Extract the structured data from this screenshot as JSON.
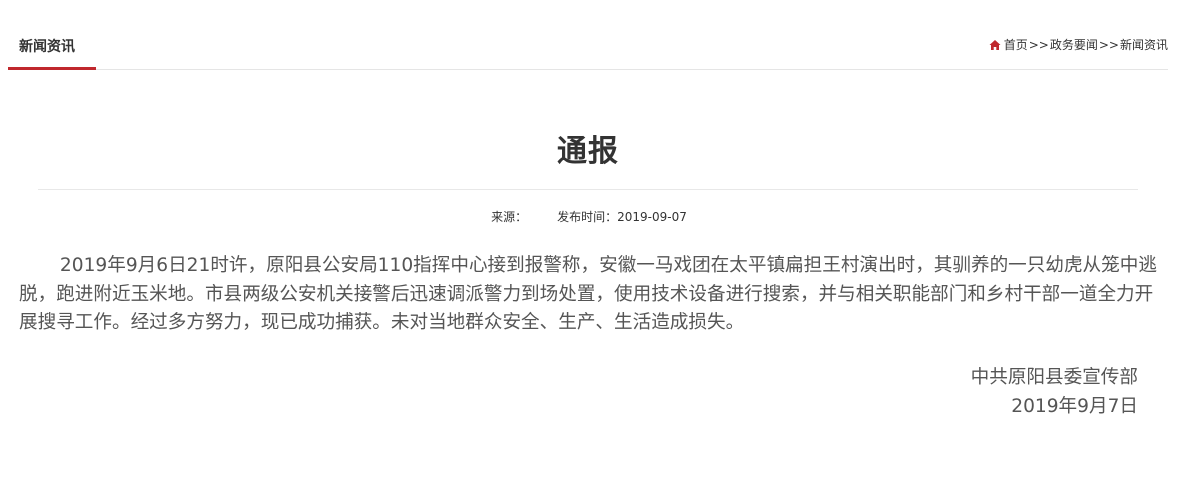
{
  "header": {
    "section_label": "新闻资讯",
    "breadcrumb": {
      "home": "首页",
      "separator": ">>",
      "level1": "政务要闻",
      "level2": "新闻资讯"
    }
  },
  "article": {
    "title": "通报",
    "source_label": "来源：",
    "source_value": "",
    "publish_label": "发布时间：",
    "publish_date": "2019-09-07",
    "body": "2019年9月6日21时许，原阳县公安局110指挥中心接到报警称，安徽一马戏团在太平镇扁担王村演出时，其驯养的一只幼虎从笼中逃脱，跑进附近玉米地。市县两级公安机关接警后迅速调派警力到场处置，使用技术设备进行搜索，并与相关职能部门和乡村干部一道全力开展搜寻工作。经过多方努力，现已成功捕获。未对当地群众安全、生产、生活造成损失。",
    "signature_org": "中共原阳县委宣传部",
    "signature_date": "2019年9月7日"
  },
  "colors": {
    "accent": "#c0282d",
    "divider": "#e5e5e5"
  },
  "icons": {
    "home": "home-icon"
  }
}
